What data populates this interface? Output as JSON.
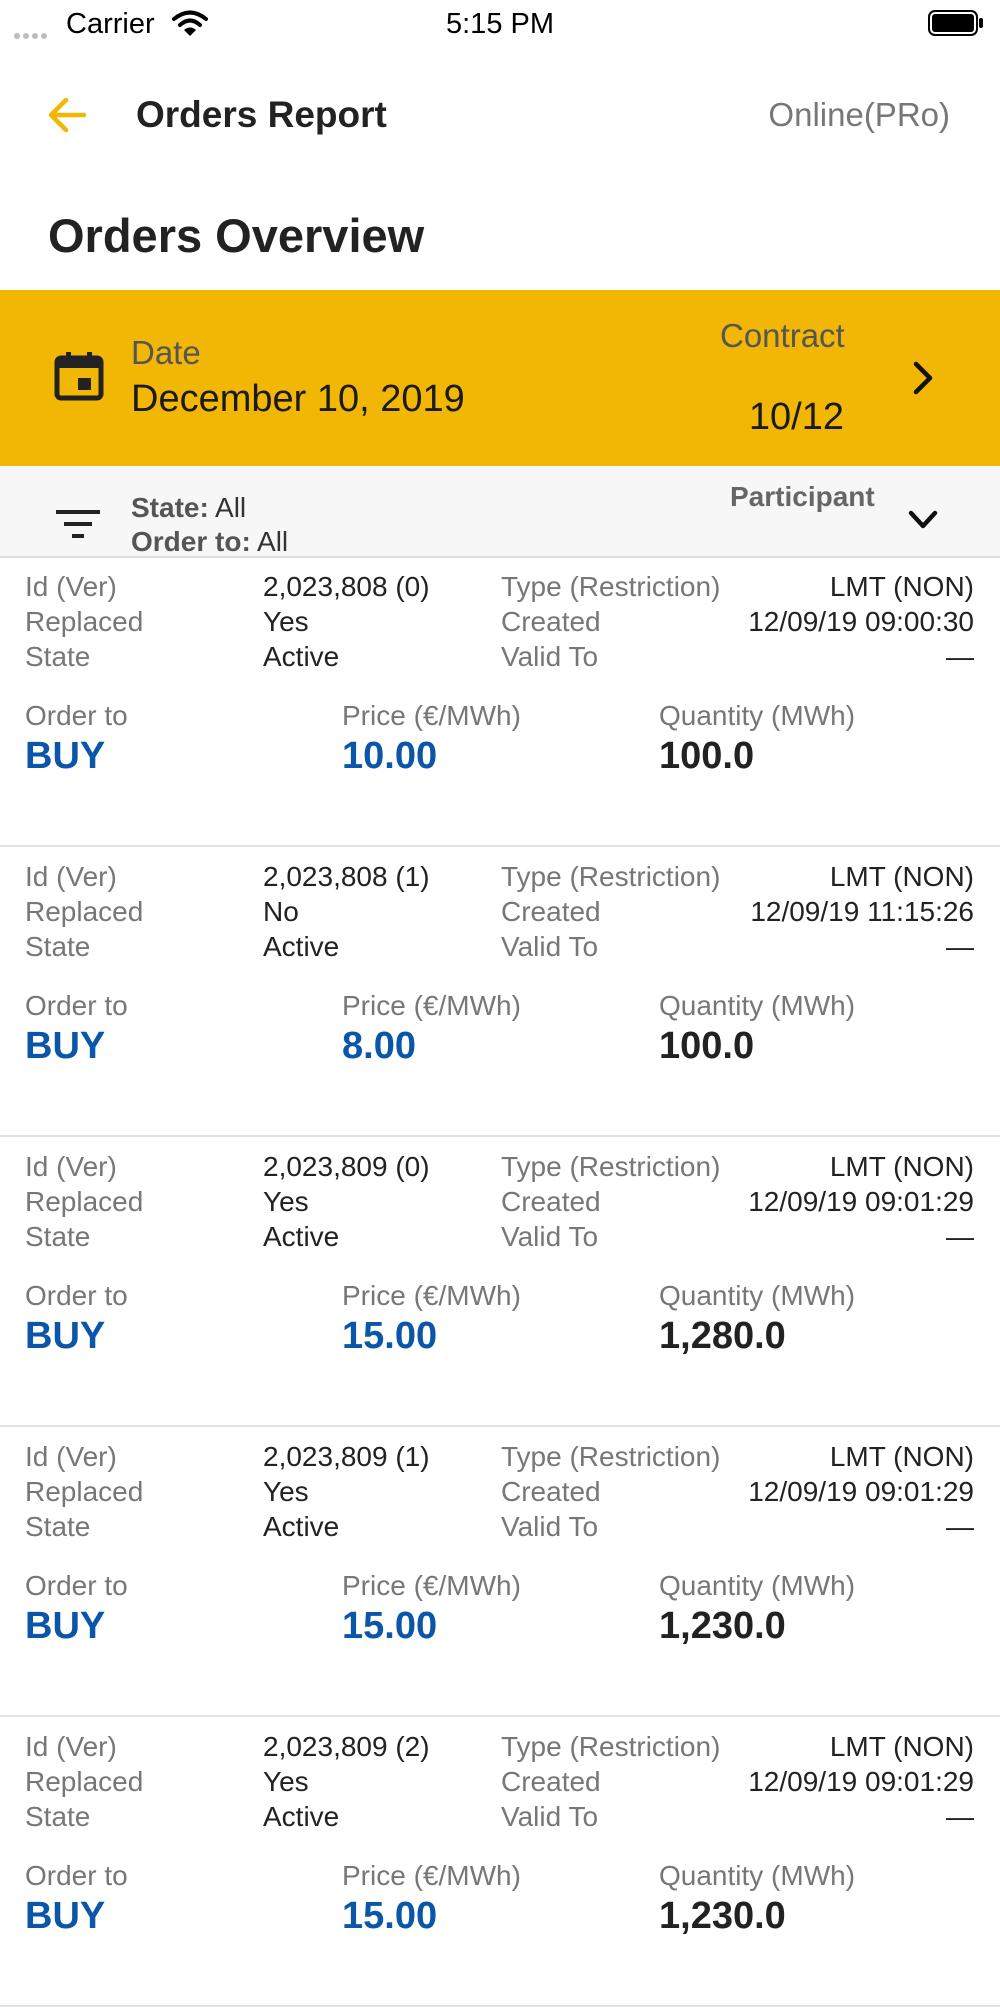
{
  "status_bar": {
    "carrier": "Carrier",
    "time": "5:15 PM"
  },
  "nav": {
    "title": "Orders Report",
    "mode": "Online(PRo)"
  },
  "overview_title": "Orders Overview",
  "date_bar": {
    "date_label": "Date",
    "date_value": "December 10, 2019",
    "contract_label": "Contract",
    "contract_value": "10/12"
  },
  "filter_bar": {
    "state_label": "State:",
    "state_value": "All",
    "order_to_label": "Order to:",
    "order_to_value": "All",
    "participant_label": "Participant"
  },
  "labels": {
    "id_ver": "Id (Ver)",
    "replaced": "Replaced",
    "state": "State",
    "type_restriction": "Type (Restriction)",
    "created": "Created",
    "valid_to": "Valid To",
    "order_to": "Order to",
    "price": "Price (€/MWh)",
    "quantity": "Quantity (MWh)"
  },
  "orders": [
    {
      "id": "2,023,808 (0)",
      "replaced": "Yes",
      "state": "Active",
      "type": "LMT (NON)",
      "created": "12/09/19 09:00:30",
      "valid_to": "—",
      "order_to": "BUY",
      "price": "10.00",
      "quantity": "100.0"
    },
    {
      "id": "2,023,808 (1)",
      "replaced": "No",
      "state": "Active",
      "type": "LMT (NON)",
      "created": "12/09/19 11:15:26",
      "valid_to": "—",
      "order_to": "BUY",
      "price": "8.00",
      "quantity": "100.0"
    },
    {
      "id": "2,023,809 (0)",
      "replaced": "Yes",
      "state": "Active",
      "type": "LMT (NON)",
      "created": "12/09/19 09:01:29",
      "valid_to": "—",
      "order_to": "BUY",
      "price": "15.00",
      "quantity": "1,280.0"
    },
    {
      "id": "2,023,809 (1)",
      "replaced": "Yes",
      "state": "Active",
      "type": "LMT (NON)",
      "created": "12/09/19 09:01:29",
      "valid_to": "—",
      "order_to": "BUY",
      "price": "15.00",
      "quantity": "1,230.0"
    },
    {
      "id": "2,023,809 (2)",
      "replaced": "Yes",
      "state": "Active",
      "type": "LMT (NON)",
      "created": "12/09/19 09:01:29",
      "valid_to": "—",
      "order_to": "BUY",
      "price": "15.00",
      "quantity": "1,230.0"
    }
  ],
  "colors": {
    "accent": "#f2b705",
    "buy": "#0b56a8"
  }
}
